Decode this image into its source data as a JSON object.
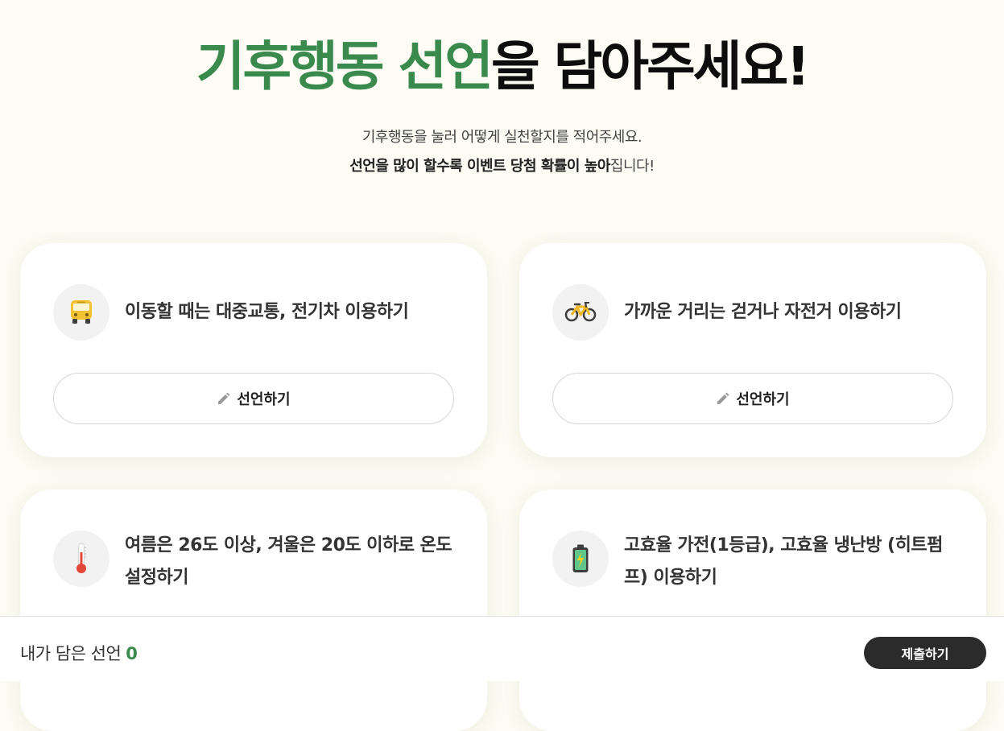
{
  "header": {
    "title_green": "기후행동 선언",
    "title_dark": "을 담아주세요!",
    "subtitle_line1": "기후행동을 눌러 어떻게 실천할지를 적어주세요.",
    "subtitle_line2_bold": "선언을 많이 할수록 이벤트 당첨 확률이 높아",
    "subtitle_line2_rest": "집니다!"
  },
  "cards": [
    {
      "icon": "bus-icon",
      "text": "이동할 때는 대중교통, 전기차 이용하기",
      "button_label": "선언하기"
    },
    {
      "icon": "bicycle-icon",
      "text": "가까운 거리는 걷거나 자전거 이용하기",
      "button_label": "선언하기"
    },
    {
      "icon": "thermometer-icon",
      "text": "여름은 26도 이상, 겨울은 20도 이하로 온도 설정하기"
    },
    {
      "icon": "battery-icon",
      "text": "고효율 가전(1등급), 고효율 냉난방 (히트펌프) 이용하기"
    }
  ],
  "footer": {
    "count_label": "내가 담은 선언",
    "count_value": "0",
    "submit_label": "제출하기"
  },
  "colors": {
    "accent_green": "#3a8a4e",
    "background": "#fcfcf4",
    "submit_button": "#2b2b2b"
  }
}
